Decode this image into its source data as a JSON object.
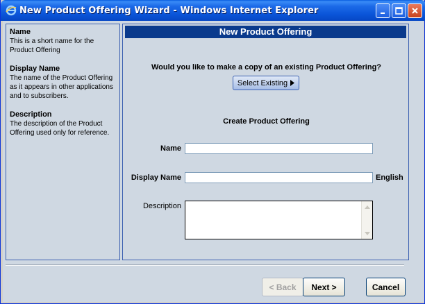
{
  "window": {
    "title": "New Product Offering Wizard - Windows Internet Explorer"
  },
  "help": [
    {
      "title": "Name",
      "text": "This is a short name for the Product Offering"
    },
    {
      "title": "Display Name",
      "text": "The name of the Product Offering as it appears in other applications and to subscribers."
    },
    {
      "title": "Description",
      "text": "The description of the Product Offering used only for reference."
    }
  ],
  "main": {
    "header": "New Product Offering",
    "question": "Would you like to make a copy of an existing Product Offering?",
    "select_existing_label": "Select Existing",
    "create_title": "Create Product Offering",
    "fields": {
      "name_label": "Name",
      "name_value": "",
      "display_name_label": "Display Name",
      "display_name_value": "",
      "display_name_language": "English",
      "description_label": "Description",
      "description_value": ""
    }
  },
  "buttons": {
    "back": "< Back",
    "next": "Next >",
    "cancel": "Cancel"
  },
  "colors": {
    "header_bg": "#0a3a8c",
    "panel_bg": "#cfd8e2",
    "panel_border": "#3a5fb0"
  }
}
